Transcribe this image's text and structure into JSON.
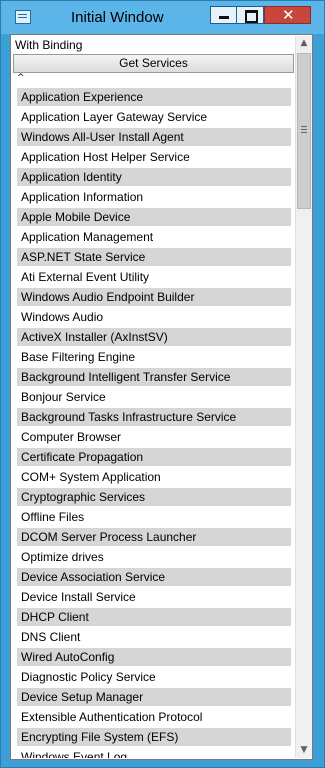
{
  "window": {
    "title": "Initial Window",
    "close_glyph": "✕",
    "icon": "app-window-icon"
  },
  "header": {
    "binding_label": "With Binding",
    "get_services_label": "Get Services",
    "sort_indicator": "^"
  },
  "scrollbar": {
    "up_arrow": "▲",
    "down_arrow": "▼"
  },
  "colors": {
    "title_bar": "#5cb5e8",
    "window_frame": "#3c9fd6",
    "close_button": "#c7463d",
    "row_alternate": "#d6d6d6"
  },
  "services": [
    "Application Experience",
    "Application Layer Gateway Service",
    "Windows All-User Install Agent",
    "Application Host Helper Service",
    "Application Identity",
    "Application Information",
    "Apple Mobile Device",
    "Application Management",
    "ASP.NET State Service",
    "Ati External Event Utility",
    "Windows Audio Endpoint Builder",
    "Windows Audio",
    "ActiveX Installer (AxInstSV)",
    "Base Filtering Engine",
    "Background Intelligent Transfer Service",
    "Bonjour Service",
    "Background Tasks Infrastructure Service",
    "Computer Browser",
    "Certificate Propagation",
    "COM+ System Application",
    "Cryptographic Services",
    "Offline Files",
    "DCOM Server Process Launcher",
    "Optimize drives",
    "Device Association Service",
    "Device Install Service",
    "DHCP Client",
    "DNS Client",
    "Wired AutoConfig",
    "Diagnostic Policy Service",
    "Device Setup Manager",
    "Extensible Authentication Protocol",
    "Encrypting File System (EFS)",
    "Windows Event Log"
  ]
}
